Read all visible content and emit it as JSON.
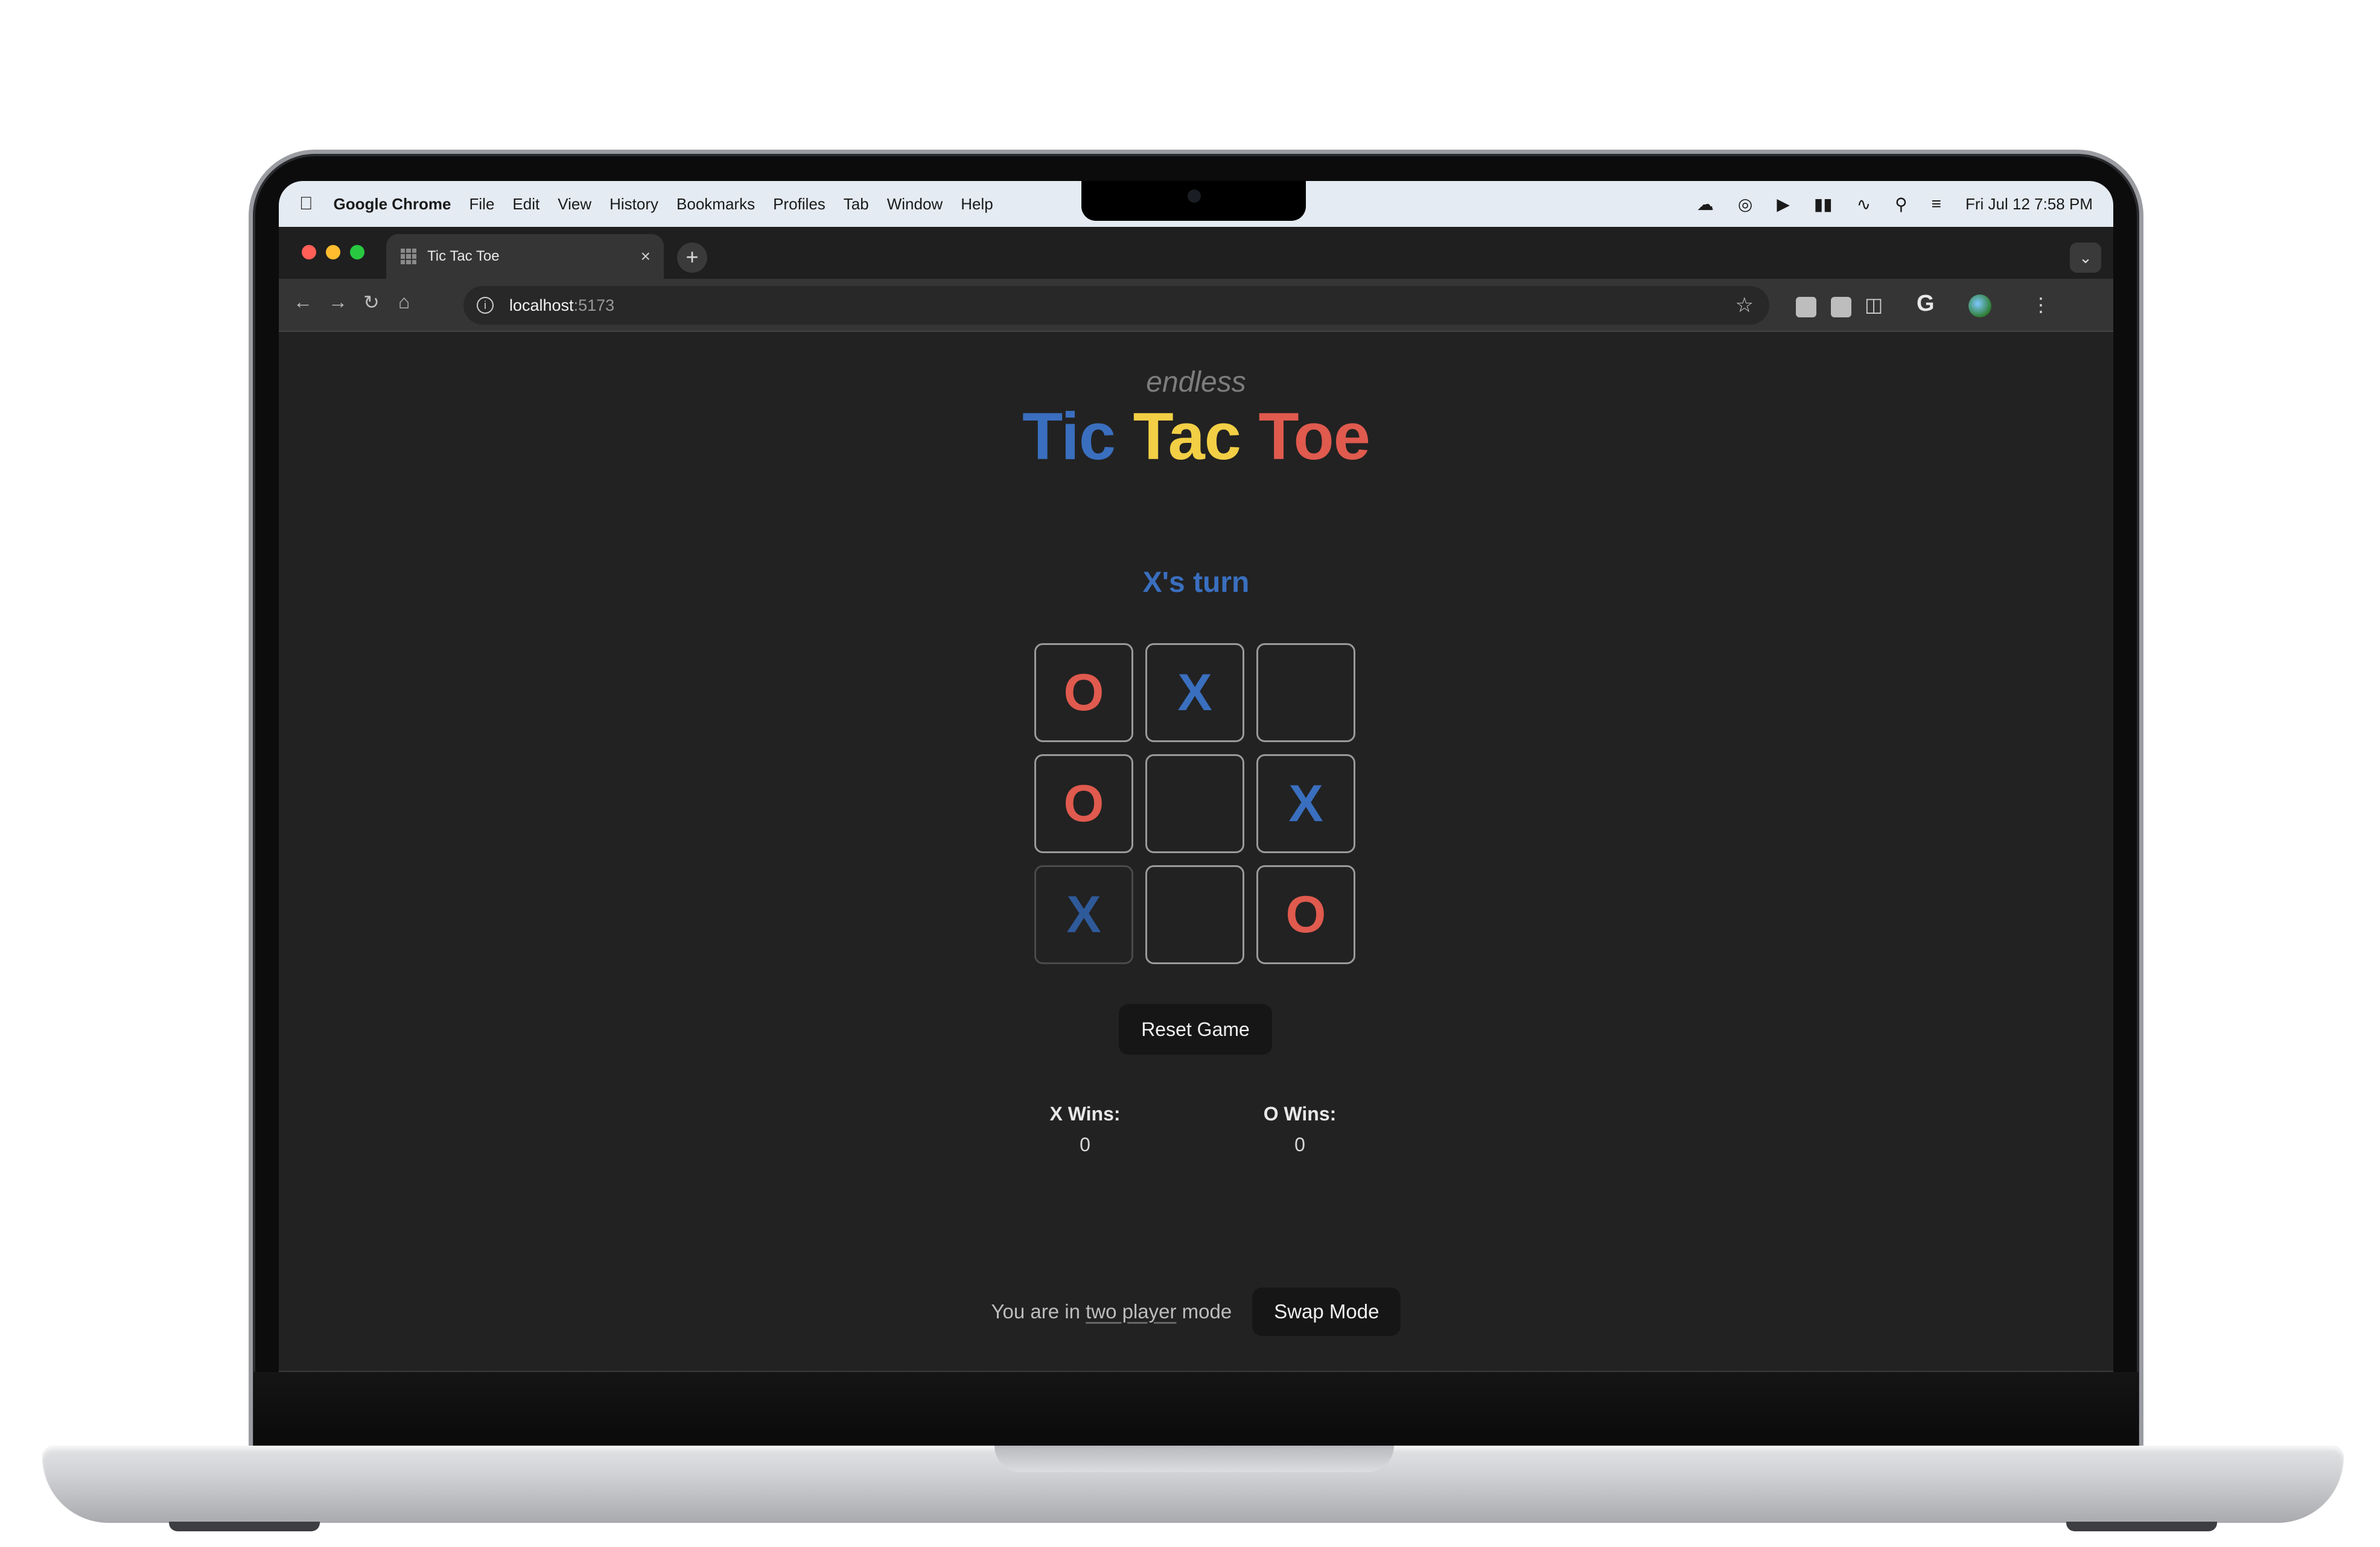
{
  "menubar": {
    "apple_icon": "apple-logo",
    "items": [
      "Google Chrome",
      "File",
      "Edit",
      "View",
      "History",
      "Bookmarks",
      "Profiles",
      "Tab",
      "Window",
      "Help"
    ],
    "datetime": "Fri Jul 12  7:58 PM",
    "status_icons": [
      "cloud-icon",
      "globe-icon",
      "play-icon",
      "battery-icon",
      "wifi-icon",
      "search-icon",
      "control-center-icon"
    ]
  },
  "browser": {
    "tab_title": "Tic Tac Toe",
    "url_host": "localhost",
    "url_port": ":5173"
  },
  "page": {
    "subtitle": "endless",
    "title_words": [
      "Tic",
      "Tac",
      "Toe"
    ],
    "turn_text": "X's turn",
    "board": [
      "O",
      "X",
      "",
      "O",
      "",
      "X",
      "X",
      "",
      "O"
    ],
    "reset_label": "Reset Game",
    "scores": {
      "x_label": "X Wins:",
      "x_value": "0",
      "o_label": "O Wins:",
      "o_value": "0"
    },
    "mode_prefix": "You are in ",
    "mode_name": "two player",
    "mode_suffix": " mode",
    "swap_label": "Swap Mode"
  },
  "colors": {
    "x": "#3a6fbf",
    "tac": "#f2cf45",
    "o": "#e05a4e",
    "background": "#222222"
  }
}
